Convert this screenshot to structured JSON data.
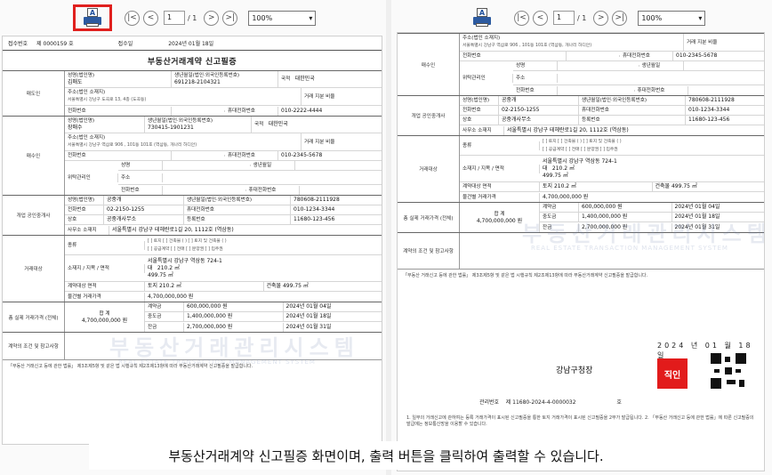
{
  "toolbar": {
    "print_icon_letter": "A",
    "first": "|<",
    "prev": "<",
    "page_current": "1",
    "page_total": "/ 1",
    "next": ">",
    "last": ">|",
    "zoom": "100%"
  },
  "doc": {
    "receipt_label": "접수번호",
    "receipt_no": "제     0000159 호",
    "receipt_date_label": "접수일",
    "receipt_date": "2024년 01월 18일",
    "title": "부동산거래계약 신고필증",
    "seller": {
      "label": "매도인",
      "name_label": "성명(법인명)",
      "name": "김매도",
      "id_label": "생년월일(법인·외국인등록번호)",
      "id": "691218-2104321",
      "nationality_label": "국적",
      "nationality": "대한민국",
      "share_label": "거래 지분 비율",
      "address_label": "주소(법인 소재지)",
      "address": "서울특별시 강남구 도곡로 13, 4층 (도곡동)",
      "phone_label": "전화번호",
      "mobile_label": "휴대전화번호",
      "mobile": "010-2222-4444"
    },
    "buyer": {
      "label": "매수인",
      "name_label": "성명(법인명)",
      "name": "장매수",
      "id_label": "생년월일(법인·외국인등록번호)",
      "id": "730415-1901231",
      "nationality_label": "국적",
      "nationality": "대한민국",
      "share_label": "거래 지분 비율",
      "address_label": "주소(법인 소재지)",
      "address": "서울특별시 강남구 역삼로 906 , 101동 101호 (역삼동, 개나리 하디안)",
      "phone_label": "전화번호",
      "mobile_label": "휴대전화번호",
      "mobile": "010-2345-5678",
      "proxy_label": "위탁관리인",
      "proxy_name_label": "성명",
      "proxy_birth_label": "생년월일",
      "proxy_addr_label": "주소",
      "proxy_phone_label": "전화번호",
      "proxy_mobile_label": "휴대전화번호"
    },
    "agent": {
      "label": "개업 공인중개사",
      "name_label": "성명(법인명)",
      "name": "공중개",
      "id_label": "생년월일(법인·외국인등록번호)",
      "id": "780608-2111928",
      "phone_label": "전화번호",
      "phone": "02-2150-1255",
      "mobile_label": "휴대전화번호",
      "mobile": "010-1234-3344",
      "office_label": "상호",
      "office": "공중개사무소",
      "reg_label": "등록번호",
      "reg": "11680-123-456",
      "addr_label": "사무소 소재지",
      "addr": "서울특별시 강남구 테헤란로1길 20, 1112호 (역삼동)"
    },
    "property": {
      "label": "거래대상",
      "kind_label": "종류",
      "kind_land": "[ ] 토지   [ ] 건축물 (    )   [ ] 토지 및 건축물 (    )",
      "kind_right": "[ ] 공급계약  [ ] 전매  [ ] 분양권  [ ] 입주권",
      "location_label": "소재지 / 지목 / 면적",
      "location": "서울특별시 강남구 역삼동 724-1",
      "land_use": "대",
      "land_area": "210.2 ㎡",
      "building_area": "499.75 ㎡",
      "contract_area_label": "계약대상 면적",
      "contract_land": "토지  210.2 ㎡",
      "contract_building": "건축물  499.75 ㎡",
      "price_label": "물건별 거래가격",
      "price": "4,700,000,000 원"
    },
    "total": {
      "label": "총 실제 거래가격 (전체)",
      "sum_label": "합 계",
      "sum": "4,700,000,000 원",
      "contract_label": "계약금",
      "contract": "600,000,000 원",
      "contract_date": "2024년 01월 04일",
      "middle_label": "중도금",
      "middle": "1,400,000,000 원",
      "middle_date": "2024년 01월 18일",
      "balance_label": "잔금",
      "balance": "2,700,000,000 원",
      "balance_date": "2024년 01월 31일"
    },
    "conditions_label": "계약의 조건 및 참고사항",
    "footnote": "「부동산 거래신고 등에 관한 법률」 제3조제5항 및 같은 법 시행규칙 제2조제13항에 따라 부동산거래계약 신고필증을 발급합니다.",
    "watermark": "부동산거래관리시스템",
    "watermark_sub": "REAL ESTATE TRANSACTION MANAGEMENT SYSTEM",
    "issue_date": "2024 년   01 월   18 일",
    "issuer": "강남구청장",
    "seal": "직인",
    "mgmt_label": "관리번호",
    "mgmt_no": "제 11680-2024-4-0000032",
    "mgmt_suffix": "호",
    "notice": "1. 일부의 거래신고에 관하여는 등록 거래가격이 표시된 신고필증을 통한 토지 거래가격이 표시된 신고필증을 2부가 발급됩니다.\n2. 「부동산 거래신고 등에 관한 법률」에 따른 신고필증의 발급에는 정보통신망을 이용할 수 있습니다."
  },
  "caption": "부동산거래계약 신고필증 화면이며, 출력 버튼을 클릭하여 출력할 수 있습니다."
}
